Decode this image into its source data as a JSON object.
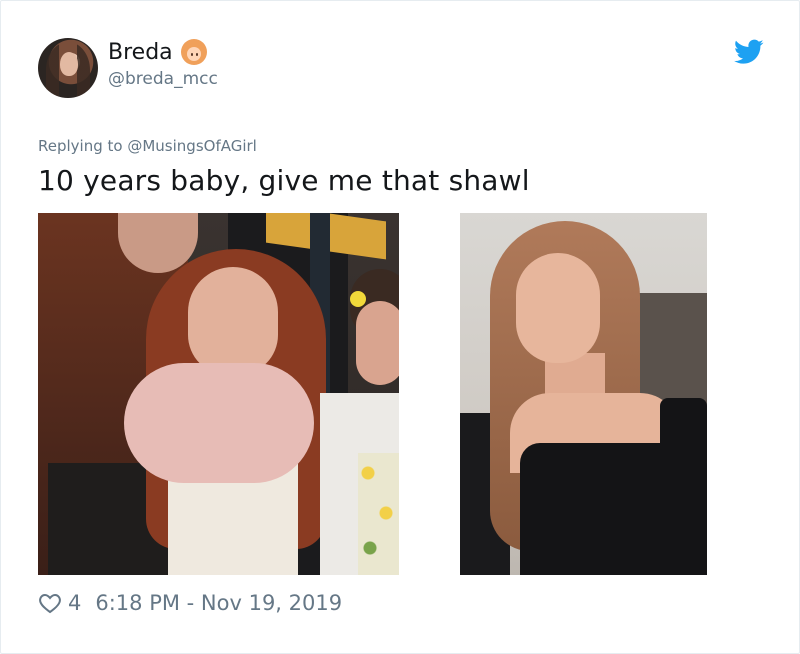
{
  "user": {
    "display_name": "Breda",
    "handle": "@breda_mcc",
    "avatar_icon": "avatar-photo",
    "name_emoji": "red-haired-woman-emoji"
  },
  "platform_icon": "twitter-bird-icon",
  "reply": {
    "prefix": "Replying to",
    "mention": "@MusingsOfAGirl"
  },
  "tweet": {
    "text": "10 years baby, give me that shawl"
  },
  "media": {
    "images": [
      "photo-then",
      "photo-now"
    ]
  },
  "footer": {
    "likes": "4",
    "timestamp": "6:18 PM - Nov 19, 2019"
  },
  "colors": {
    "twitter_blue": "#1da1f2",
    "secondary_text": "#657786",
    "primary_text": "#14171a"
  }
}
